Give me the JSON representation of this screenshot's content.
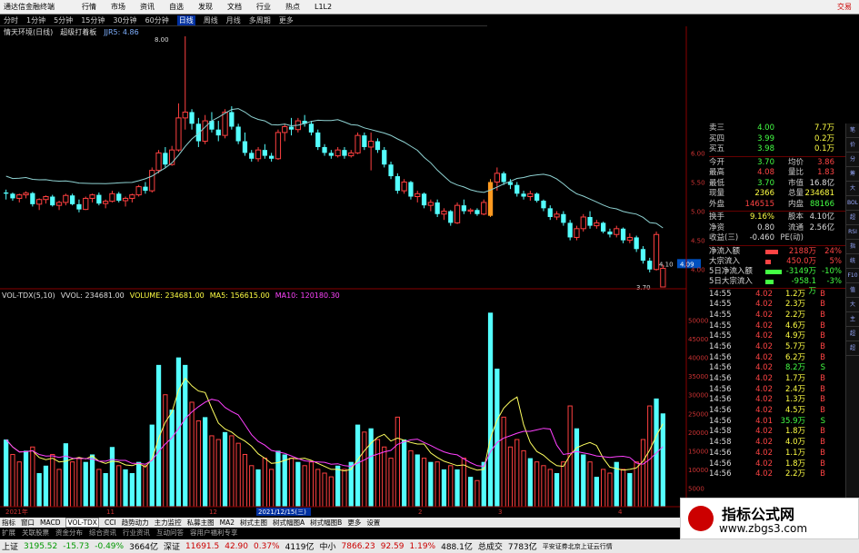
{
  "menubar": {
    "title": "通达信金融终端",
    "items": [
      "行情",
      "市场",
      "资讯",
      "自选",
      "发现",
      "文档",
      "行业",
      "热点",
      "L1L2"
    ],
    "accent_item": "交易",
    "accent_color": "#cc0000"
  },
  "periods": {
    "stock_label": "情天环境(日线)",
    "items": [
      "分时",
      "1分钟",
      "5分钟",
      "15分钟",
      "30分钟",
      "60分钟",
      "日线",
      "周线",
      "月线",
      "多周期",
      "更多"
    ],
    "active": "日线"
  },
  "main_indicator": {
    "title": "情天环境(日线)",
    "sub": "超级打着板",
    "ind": "JJR5: 4.86",
    "ind_color": "#7fb0ff"
  },
  "price_axis": [
    "6.00",
    "5.50",
    "5.00",
    "4.50",
    "4.00"
  ],
  "price_labels": {
    "high": "8.00",
    "low": "3.70",
    "current_left": "4.10",
    "current_box": "4.09"
  },
  "vol_info": {
    "name": "VOL-TDX(5,10)",
    "vvol": "VVOL: 234681.00",
    "volume": "VOLUME: 234681.00",
    "ma5": "MA5: 156615.00",
    "ma10": "MA10: 120180.30"
  },
  "vol_axis": [
    "50000",
    "45000",
    "40000",
    "35000",
    "30000",
    "25000",
    "20000",
    "15000",
    "10000",
    "5000"
  ],
  "date_labels": [
    "2021年",
    "11",
    "12",
    "2021/12/15(三)",
    "2",
    "3",
    "4"
  ],
  "quotes": [
    {
      "l1": "卖三",
      "v1": "4.00",
      "l2": "",
      "v2": "7.7万",
      "c1": "#4f4",
      "c2": "#ff4"
    },
    {
      "l1": "买四",
      "v1": "3.99",
      "l2": "",
      "v2": "0.2万",
      "c1": "#4f4",
      "c2": "#ff4"
    },
    {
      "l1": "买五",
      "v1": "3.98",
      "l2": "",
      "v2": "0.1万",
      "c1": "#4f4",
      "c2": "#ff4"
    }
  ],
  "stats": [
    {
      "l1": "今开",
      "v1": "3.70",
      "l2": "均价",
      "v2": "3.86",
      "c1": "#4f4",
      "c2": "#f44"
    },
    {
      "l1": "最高",
      "v1": "4.08",
      "l2": "量比",
      "v2": "1.83",
      "c1": "#f44",
      "c2": "#f44"
    },
    {
      "l1": "最低",
      "v1": "3.70",
      "l2": "市值",
      "v2": "16.8亿",
      "c1": "#4f4",
      "c2": "#ddd"
    },
    {
      "l1": "现量",
      "v1": "2366",
      "l2": "总量",
      "v2": "234681",
      "c1": "#ff4",
      "c2": "#ff4"
    },
    {
      "l1": "外盘",
      "v1": "146515",
      "l2": "内盘",
      "v2": "88166",
      "c1": "#f44",
      "c2": "#4f4"
    }
  ],
  "stats2": [
    {
      "l1": "换手",
      "v1": "9.16%",
      "l2": "股本",
      "v2": "4.10亿",
      "c1": "#ff4",
      "c2": "#ddd"
    },
    {
      "l1": "净资",
      "v1": "0.80",
      "l2": "流通",
      "v2": "2.56亿",
      "c1": "#ddd",
      "c2": "#ddd"
    },
    {
      "l1": "收益(三)",
      "v1": "-0.460",
      "l2": "PE(动)",
      "v2": "",
      "c1": "#ddd",
      "c2": "#ddd"
    }
  ],
  "flows": [
    {
      "label": "净流入额",
      "val": "2188万",
      "pct": "24%",
      "color": "#f44",
      "w": 14
    },
    {
      "label": "大宗流入",
      "val": "450.0万",
      "pct": "5%",
      "color": "#f44",
      "w": 6
    },
    {
      "label": "5日净流入额",
      "val": "-3149万",
      "pct": "-10%",
      "color": "#4f4",
      "w": 18
    },
    {
      "label": "5日大宗流入",
      "val": "-958.1万",
      "pct": "-3%",
      "color": "#4f4",
      "w": 9
    }
  ],
  "ticks": [
    {
      "t": "14:55",
      "p": "4.02",
      "v": "1.2万",
      "bs": "B"
    },
    {
      "t": "14:55",
      "p": "4.02",
      "v": "2.3万",
      "bs": "B"
    },
    {
      "t": "14:55",
      "p": "4.02",
      "v": "2.2万",
      "bs": "B"
    },
    {
      "t": "14:55",
      "p": "4.02",
      "v": "4.6万",
      "bs": "B"
    },
    {
      "t": "14:55",
      "p": "4.02",
      "v": "4.9万",
      "bs": "B"
    },
    {
      "t": "14:56",
      "p": "4.02",
      "v": "5.7万",
      "bs": "B"
    },
    {
      "t": "14:56",
      "p": "4.02",
      "v": "6.2万",
      "bs": "B"
    },
    {
      "t": "14:56",
      "p": "4.02",
      "v": "8.2万",
      "bs": "S"
    },
    {
      "t": "14:56",
      "p": "4.02",
      "v": "1.7万",
      "bs": "B"
    },
    {
      "t": "14:56",
      "p": "4.02",
      "v": "2.4万",
      "bs": "B"
    },
    {
      "t": "14:56",
      "p": "4.02",
      "v": "1.3万",
      "bs": "B"
    },
    {
      "t": "14:56",
      "p": "4.02",
      "v": "4.5万",
      "bs": "B"
    },
    {
      "t": "14:56",
      "p": "4.01",
      "v": "35.9万",
      "bs": "S"
    },
    {
      "t": "14:58",
      "p": "4.02",
      "v": "1.8万",
      "bs": "B"
    },
    {
      "t": "14:58",
      "p": "4.02",
      "v": "4.0万",
      "bs": "B"
    },
    {
      "t": "14:56",
      "p": "4.02",
      "v": "1.1万",
      "bs": "B"
    },
    {
      "t": "14:56",
      "p": "4.02",
      "v": "1.8万",
      "bs": "B"
    },
    {
      "t": "14:56",
      "p": "4.02",
      "v": "2.2万",
      "bs": "B"
    }
  ],
  "sidebar": [
    "笔",
    "价",
    "分",
    "筹",
    "大",
    "BOL",
    "超",
    "RSI",
    "指",
    "统",
    "F10",
    "值",
    "大",
    "主",
    "超",
    "超"
  ],
  "tabs": [
    "指标",
    "窗口",
    "MACD",
    "VOL-TDX",
    "CCI",
    "趋势动力",
    "主力监控",
    "私募主图",
    "MA2",
    "树式主图",
    "树式幅图A",
    "树式幅图B",
    "更多",
    "设置"
  ],
  "active_tab": "VOL-TDX",
  "subtabs": [
    "扩展",
    "关联股票",
    "资金分布",
    "综合资讯",
    "行业资讯",
    "互动问答",
    "容用户福利专享"
  ],
  "status": [
    {
      "label": "上证",
      "val": "3195.52",
      "chg": "-15.73",
      "pct": "-0.49%",
      "amt": "3664亿",
      "c": "#009900"
    },
    {
      "label": "深证",
      "val": "11691.5",
      "chg": "42.90",
      "pct": "0.37%",
      "amt": "4119亿",
      "c": "#cc0000"
    },
    {
      "label": "中小",
      "val": "7866.23",
      "chg": "92.59",
      "pct": "1.19%",
      "amt": "488.1亿",
      "c": "#cc0000"
    }
  ],
  "status_total": "总成交",
  "status_total_val": "7783亿",
  "status_extra": "平安证券北京上证云行情",
  "watermark": {
    "title": "指标公式网",
    "url": "www.zbgs3.com"
  },
  "chart_data": {
    "type": "candlestick",
    "candles": [
      [
        5.32,
        5.37,
        5.2,
        5.3
      ],
      [
        5.3,
        5.32,
        5.18,
        5.22
      ],
      [
        5.22,
        5.3,
        5.15,
        5.28
      ],
      [
        5.28,
        5.34,
        5.22,
        5.31
      ],
      [
        5.31,
        5.33,
        5.08,
        5.12
      ],
      [
        5.12,
        5.22,
        5.02,
        5.2
      ],
      [
        5.2,
        5.27,
        5.13,
        5.25
      ],
      [
        5.25,
        5.28,
        5.08,
        5.1
      ],
      [
        5.1,
        5.18,
        5.02,
        5.15
      ],
      [
        5.15,
        5.3,
        5.1,
        5.27
      ],
      [
        5.27,
        5.3,
        5.1,
        5.12
      ],
      [
        5.12,
        5.2,
        4.98,
        5.03
      ],
      [
        5.03,
        5.25,
        5.02,
        5.22
      ],
      [
        5.22,
        5.3,
        5.15,
        5.28
      ],
      [
        5.28,
        5.32,
        5.1,
        5.13
      ],
      [
        5.13,
        5.2,
        5.05,
        5.17
      ],
      [
        5.17,
        5.35,
        5.15,
        5.3
      ],
      [
        5.3,
        5.33,
        5.15,
        5.18
      ],
      [
        5.18,
        5.25,
        5.08,
        5.22
      ],
      [
        5.22,
        5.3,
        5.15,
        5.28
      ],
      [
        5.28,
        5.45,
        5.25,
        5.42
      ],
      [
        5.42,
        5.5,
        5.3,
        5.35
      ],
      [
        5.35,
        5.75,
        5.32,
        5.7
      ],
      [
        5.7,
        6.05,
        5.65,
        6.0
      ],
      [
        6.0,
        6.1,
        5.75,
        5.8
      ],
      [
        5.8,
        6.12,
        5.78,
        6.05
      ],
      [
        6.05,
        6.85,
        6.02,
        6.6
      ],
      [
        6.6,
        8.0,
        6.4,
        6.7
      ],
      [
        6.7,
        6.75,
        6.4,
        6.5
      ],
      [
        6.5,
        6.6,
        6.1,
        6.2
      ],
      [
        6.2,
        6.65,
        6.15,
        6.55
      ],
      [
        6.55,
        6.7,
        6.35,
        6.4
      ],
      [
        6.4,
        6.55,
        6.2,
        6.3
      ],
      [
        6.3,
        6.75,
        6.25,
        6.7
      ],
      [
        6.7,
        6.8,
        6.4,
        6.45
      ],
      [
        6.45,
        6.5,
        6.15,
        6.2
      ],
      [
        6.2,
        6.35,
        5.95,
        6.0
      ],
      [
        6.0,
        6.05,
        5.85,
        5.9
      ],
      [
        5.9,
        6.1,
        5.85,
        6.05
      ],
      [
        6.05,
        6.15,
        5.9,
        5.95
      ],
      [
        5.95,
        6.0,
        5.85,
        5.9
      ],
      [
        5.9,
        6.4,
        5.88,
        6.35
      ],
      [
        6.35,
        6.5,
        6.2,
        6.45
      ],
      [
        6.45,
        6.6,
        6.3,
        6.4
      ],
      [
        6.4,
        6.6,
        6.35,
        6.55
      ],
      [
        6.55,
        6.65,
        6.45,
        6.5
      ],
      [
        6.5,
        6.55,
        6.3,
        6.35
      ],
      [
        6.35,
        6.4,
        6.05,
        6.1
      ],
      [
        6.1,
        6.15,
        5.95,
        6.0
      ],
      [
        6.0,
        6.05,
        5.9,
        5.95
      ],
      [
        5.95,
        6.1,
        5.92,
        6.05
      ],
      [
        6.05,
        6.1,
        5.9,
        5.95
      ],
      [
        5.95,
        6.05,
        5.92,
        6.0
      ],
      [
        6.0,
        6.35,
        5.98,
        6.3
      ],
      [
        6.3,
        6.35,
        6.05,
        6.1
      ],
      [
        6.1,
        6.35,
        5.7,
        6.2
      ],
      [
        6.2,
        6.25,
        6.0,
        6.05
      ],
      [
        6.05,
        6.1,
        5.75,
        5.8
      ],
      [
        5.8,
        5.85,
        5.55,
        5.6
      ],
      [
        5.6,
        5.65,
        5.3,
        5.35
      ],
      [
        5.35,
        5.55,
        5.3,
        5.5
      ],
      [
        5.5,
        5.52,
        5.2,
        5.25
      ],
      [
        5.25,
        5.35,
        5.15,
        5.3
      ],
      [
        5.3,
        5.32,
        5.05,
        5.1
      ],
      [
        5.1,
        5.2,
        5.0,
        5.15
      ],
      [
        5.15,
        5.2,
        4.9,
        4.95
      ],
      [
        4.95,
        5.05,
        4.85,
        5.0
      ],
      [
        5.0,
        5.02,
        4.75,
        4.8
      ],
      [
        4.8,
        5.15,
        4.78,
        5.1
      ],
      [
        5.1,
        5.2,
        4.95,
        5.0
      ],
      [
        5.0,
        5.05,
        4.95,
        5.02
      ],
      [
        5.02,
        5.05,
        4.92,
        4.95
      ],
      [
        4.95,
        5.2,
        4.93,
        5.15
      ],
      [
        4.92,
        5.55,
        4.9,
        5.5
      ],
      [
        5.5,
        5.75,
        5.35,
        5.65
      ],
      [
        5.65,
        5.68,
        5.45,
        5.5
      ],
      [
        5.5,
        5.55,
        5.38,
        5.45
      ],
      [
        5.45,
        5.5,
        5.25,
        5.3
      ],
      [
        5.3,
        5.35,
        5.2,
        5.25
      ],
      [
        5.25,
        5.35,
        5.18,
        5.3
      ],
      [
        5.3,
        5.32,
        5.15,
        5.18
      ],
      [
        5.18,
        5.2,
        5.0,
        5.05
      ],
      [
        5.05,
        5.1,
        4.85,
        4.9
      ],
      [
        4.9,
        5.0,
        4.85,
        4.95
      ],
      [
        4.95,
        5.0,
        4.75,
        4.8
      ],
      [
        4.8,
        4.85,
        4.5,
        4.55
      ],
      [
        4.55,
        4.75,
        4.5,
        4.7
      ],
      [
        4.7,
        4.95,
        4.65,
        4.9
      ],
      [
        4.9,
        5.0,
        4.7,
        4.75
      ],
      [
        4.75,
        4.85,
        4.7,
        4.8
      ],
      [
        4.8,
        4.82,
        4.62,
        4.65
      ],
      [
        4.65,
        4.7,
        4.55,
        4.6
      ],
      [
        4.6,
        4.75,
        4.55,
        4.7
      ],
      [
        4.7,
        4.72,
        4.45,
        4.5
      ],
      [
        4.5,
        4.62,
        4.45,
        4.55
      ],
      [
        4.55,
        4.58,
        4.3,
        4.35
      ],
      [
        4.35,
        4.4,
        4.1,
        4.15
      ],
      [
        4.15,
        4.2,
        3.95,
        4.0
      ],
      [
        4.0,
        4.65,
        3.98,
        4.6
      ],
      [
        3.7,
        4.08,
        3.7,
        4.02
      ]
    ],
    "volumes": [
      [
        18000,
        0
      ],
      [
        14000,
        1
      ],
      [
        12000,
        1
      ],
      [
        15000,
        0
      ],
      [
        16000,
        1
      ],
      [
        9000,
        0
      ],
      [
        11000,
        0
      ],
      [
        14000,
        1
      ],
      [
        10000,
        1
      ],
      [
        17000,
        0
      ],
      [
        12000,
        1
      ],
      [
        13000,
        1
      ],
      [
        12000,
        0
      ],
      [
        14000,
        0
      ],
      [
        10000,
        1
      ],
      [
        9000,
        0
      ],
      [
        16000,
        0
      ],
      [
        11000,
        1
      ],
      [
        10000,
        0
      ],
      [
        9000,
        0
      ],
      [
        12000,
        0
      ],
      [
        11000,
        1
      ],
      [
        22000,
        0
      ],
      [
        38000,
        0
      ],
      [
        30000,
        1
      ],
      [
        26000,
        0
      ],
      [
        40000,
        0
      ],
      [
        38000,
        0
      ],
      [
        28000,
        1
      ],
      [
        23000,
        1
      ],
      [
        24000,
        0
      ],
      [
        19000,
        1
      ],
      [
        18000,
        1
      ],
      [
        20000,
        0
      ],
      [
        19000,
        1
      ],
      [
        17000,
        1
      ],
      [
        14000,
        1
      ],
      [
        11000,
        1
      ],
      [
        10000,
        0
      ],
      [
        13000,
        1
      ],
      [
        10000,
        1
      ],
      [
        15000,
        0
      ],
      [
        14000,
        0
      ],
      [
        13000,
        1
      ],
      [
        12000,
        0
      ],
      [
        11000,
        1
      ],
      [
        12000,
        1
      ],
      [
        10000,
        1
      ],
      [
        9000,
        1
      ],
      [
        8000,
        1
      ],
      [
        11000,
        0
      ],
      [
        10000,
        1
      ],
      [
        12000,
        0
      ],
      [
        22000,
        0
      ],
      [
        20000,
        1
      ],
      [
        21000,
        0
      ],
      [
        18000,
        1
      ],
      [
        16000,
        1
      ],
      [
        13000,
        1
      ],
      [
        24000,
        1
      ],
      [
        18000,
        0
      ],
      [
        15000,
        1
      ],
      [
        14000,
        0
      ],
      [
        13000,
        1
      ],
      [
        12000,
        0
      ],
      [
        12000,
        1
      ],
      [
        10000,
        0
      ],
      [
        11000,
        1
      ],
      [
        10000,
        0
      ],
      [
        13000,
        1
      ],
      [
        8000,
        0
      ],
      [
        7000,
        1
      ],
      [
        12000,
        0
      ],
      [
        52000,
        0
      ],
      [
        37000,
        0
      ],
      [
        24000,
        1
      ],
      [
        16000,
        1
      ],
      [
        18000,
        1
      ],
      [
        15000,
        1
      ],
      [
        13000,
        0
      ],
      [
        12000,
        1
      ],
      [
        11000,
        1
      ],
      [
        10000,
        1
      ],
      [
        9000,
        0
      ],
      [
        12000,
        1
      ],
      [
        27000,
        1
      ],
      [
        21000,
        0
      ],
      [
        14000,
        0
      ],
      [
        12000,
        1
      ],
      [
        8000,
        0
      ],
      [
        10000,
        1
      ],
      [
        9000,
        1
      ],
      [
        12000,
        0
      ],
      [
        10000,
        1
      ],
      [
        9000,
        0
      ],
      [
        12000,
        1
      ],
      [
        18000,
        1
      ],
      [
        27000,
        1
      ],
      [
        29000,
        0
      ],
      [
        25000,
        0
      ]
    ],
    "ylim": [
      3.7,
      8.0
    ],
    "vol_ylim": [
      0,
      55000
    ]
  }
}
